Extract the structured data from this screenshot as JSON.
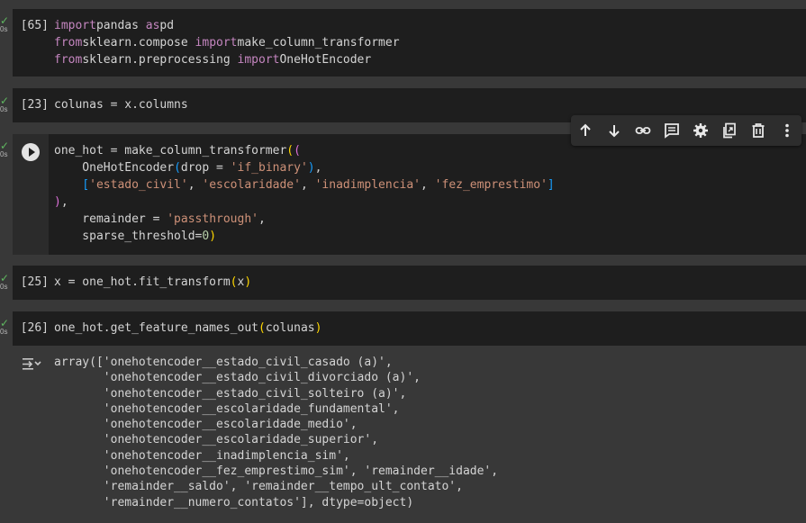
{
  "status_label": "0s",
  "cells": [
    {
      "exec_count": "[65]",
      "lines": [
        [
          [
            "kw",
            "import"
          ],
          [
            "",
            "pandas "
          ],
          [
            "kw",
            "as"
          ],
          [
            "",
            "pd"
          ]
        ],
        [
          [
            "kw",
            "from"
          ],
          [
            "",
            "sklearn.compose "
          ],
          [
            "kw",
            "import"
          ],
          [
            "",
            "make_column_transformer"
          ]
        ],
        [
          [
            "kw",
            "from"
          ],
          [
            "",
            "sklearn.preprocessing "
          ],
          [
            "kw",
            "import"
          ],
          [
            "",
            "OneHotEncoder"
          ]
        ]
      ]
    },
    {
      "exec_count": "[23]",
      "lines": [
        [
          [
            "",
            "colunas = x.columns"
          ]
        ]
      ]
    },
    {
      "exec_count": "",
      "lines": [
        [
          [
            "",
            "one_hot = make_column_transformer"
          ],
          [
            "p1",
            "("
          ],
          [
            "p2",
            "("
          ]
        ],
        [
          [
            "",
            "    OneHotEncoder"
          ],
          [
            "p3",
            "("
          ],
          [
            "",
            "drop = "
          ],
          [
            "str",
            "'if_binary'"
          ],
          [
            "p3",
            ")"
          ],
          [
            "",
            ","
          ]
        ],
        [
          [
            "p3",
            "    ["
          ],
          [
            "str",
            "'estado_civil'"
          ],
          [
            "",
            ", "
          ],
          [
            "str",
            "'escolaridade'"
          ],
          [
            "",
            ", "
          ],
          [
            "str",
            "'inadimplencia'"
          ],
          [
            "",
            ", "
          ],
          [
            "str",
            "'fez_emprestimo'"
          ],
          [
            "p3",
            "]"
          ]
        ],
        [
          [
            "p2",
            ")"
          ],
          [
            "",
            ","
          ]
        ],
        [
          [
            "",
            "    remainder = "
          ],
          [
            "str",
            "'passthrough'"
          ],
          [
            "",
            ","
          ]
        ],
        [
          [
            "",
            "    sparse_threshold="
          ],
          [
            "num",
            "0"
          ],
          [
            "p1",
            ")"
          ]
        ]
      ]
    },
    {
      "exec_count": "[25]",
      "lines": [
        [
          [
            "",
            "x = one_hot.fit_transform"
          ],
          [
            "p1",
            "("
          ],
          [
            "",
            "x"
          ],
          [
            "p1",
            ")"
          ]
        ]
      ]
    },
    {
      "exec_count": "[26]",
      "lines": [
        [
          [
            "",
            "one_hot.get_feature_names_out"
          ],
          [
            "p1",
            "("
          ],
          [
            "",
            "colunas"
          ],
          [
            "p1",
            ")"
          ]
        ]
      ]
    }
  ],
  "output_lines": [
    "array(['onehotencoder__estado_civil_casado (a)',",
    "       'onehotencoder__estado_civil_divorciado (a)',",
    "       'onehotencoder__estado_civil_solteiro (a)',",
    "       'onehotencoder__escolaridade_fundamental',",
    "       'onehotencoder__escolaridade_medio',",
    "       'onehotencoder__escolaridade_superior',",
    "       'onehotencoder__inadimplencia_sim',",
    "       'onehotencoder__fez_emprestimo_sim', 'remainder__idade',",
    "       'remainder__saldo', 'remainder__tempo_ult_contato',",
    "       'remainder__numero_contatos'], dtype=object)"
  ],
  "toolbar_icons": [
    "move-up-icon",
    "move-down-icon",
    "link-icon",
    "comment-icon",
    "settings-icon",
    "mirror-cell-icon",
    "delete-icon",
    "more-icon"
  ]
}
